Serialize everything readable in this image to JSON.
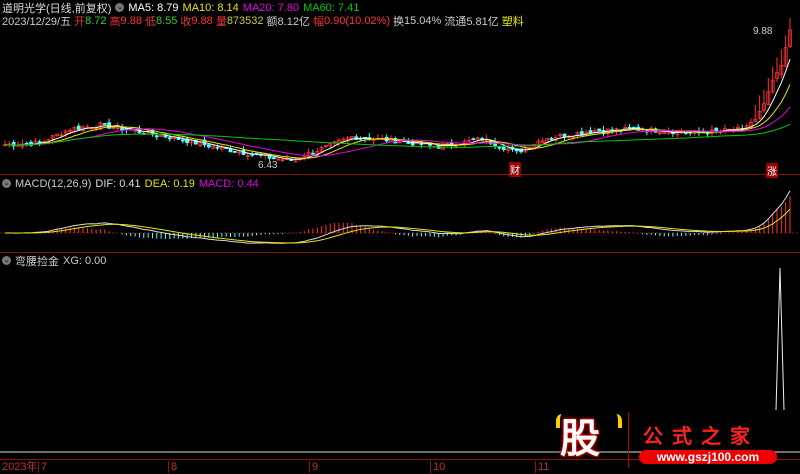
{
  "header": {
    "title": "道明光学(日线,前复权)",
    "ma5": "MA5: 8.79",
    "ma10": "MA10: 8.14",
    "ma20": "MA20: 7.80",
    "ma60": "MA60: 7.41"
  },
  "quote": {
    "date": "2023/12/29/五",
    "open_l": "开",
    "open": "8.72",
    "high_l": "高",
    "high": "9.88",
    "low_l": "低",
    "low": "8.55",
    "close_l": "收",
    "close": "9.88",
    "vol_l": "量",
    "vol": "873532",
    "amt_l": "额",
    "amt": "8.12亿",
    "chg_l": "幅",
    "chg": "0.90(10.02%)",
    "turn_l": "换",
    "turn": "15.04%",
    "float_l": "流通",
    "float": "5.81亿",
    "sector": "塑料"
  },
  "main": {
    "max_label": "9.88",
    "min_label": "6.43",
    "marker_cai": "财",
    "marker_zhang": "涨"
  },
  "macd": {
    "title": "MACD(12,26,9)",
    "dif": "DIF: 0.41",
    "dea": "DEA: 0.19",
    "macd": "MACD: 0.44"
  },
  "xg": {
    "title": "弯腰捡金",
    "value": "XG: 0.00"
  },
  "xaxis": {
    "year": "2023年",
    "months": [
      "7",
      "8",
      "9",
      "10",
      "11"
    ]
  },
  "logo": {
    "glyph": "股",
    "name": "公式之家",
    "url": "www.gszj100.com"
  },
  "colors": {
    "up": "#ff3232",
    "down": "#54ffff",
    "ma5": "#ffffff",
    "ma10": "#e6e600",
    "ma20": "#e600e6",
    "ma60": "#00c800"
  },
  "price_path": [
    [
      0,
      6.95
    ],
    [
      8,
      7.0
    ],
    [
      15,
      7.35
    ],
    [
      22,
      7.45
    ],
    [
      30,
      7.3
    ],
    [
      40,
      7.1
    ],
    [
      50,
      6.85
    ],
    [
      62,
      6.6
    ],
    [
      66,
      6.55
    ],
    [
      72,
      6.8
    ],
    [
      80,
      7.15
    ],
    [
      90,
      7.05
    ],
    [
      100,
      6.9
    ],
    [
      110,
      7.1
    ],
    [
      118,
      6.75
    ],
    [
      124,
      7.1
    ],
    [
      135,
      7.3
    ],
    [
      145,
      7.35
    ],
    [
      160,
      7.25
    ],
    [
      170,
      7.35
    ],
    [
      173,
      7.6
    ],
    [
      175,
      8.0
    ],
    [
      177,
      8.6
    ],
    [
      179,
      8.98
    ],
    [
      181,
      9.88
    ]
  ]
}
